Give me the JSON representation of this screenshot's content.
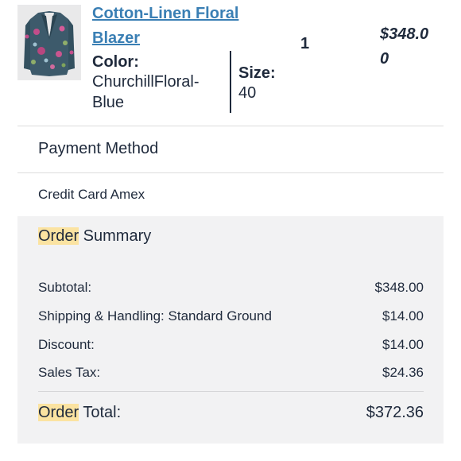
{
  "product": {
    "name": "Cotton-Linen Floral Blazer",
    "color_label": "Color:",
    "color_value": "ChurchillFloral-Blue",
    "size_label": "Size:",
    "size_value": "40",
    "quantity": "1",
    "price": "$348.00"
  },
  "payment": {
    "title": "Payment Method",
    "value": "Credit Card Amex"
  },
  "summary": {
    "title_highlight": "Order",
    "title_rest": " Summary",
    "rows": [
      {
        "label": "Subtotal:",
        "value": "$348.00"
      },
      {
        "label": "Shipping & Handling: Standard Ground",
        "value": "$14.00"
      },
      {
        "label": "Discount:",
        "value": "$14.00"
      },
      {
        "label": "Sales Tax:",
        "value": "$24.36"
      }
    ],
    "total_highlight": "Order",
    "total_rest": " Total:",
    "total_value": "$372.36"
  },
  "colors": {
    "link": "#3a7fb4",
    "text": "#1f2a3c",
    "highlight": "#fbe3a1",
    "summary_bg": "#f2f2f3"
  }
}
